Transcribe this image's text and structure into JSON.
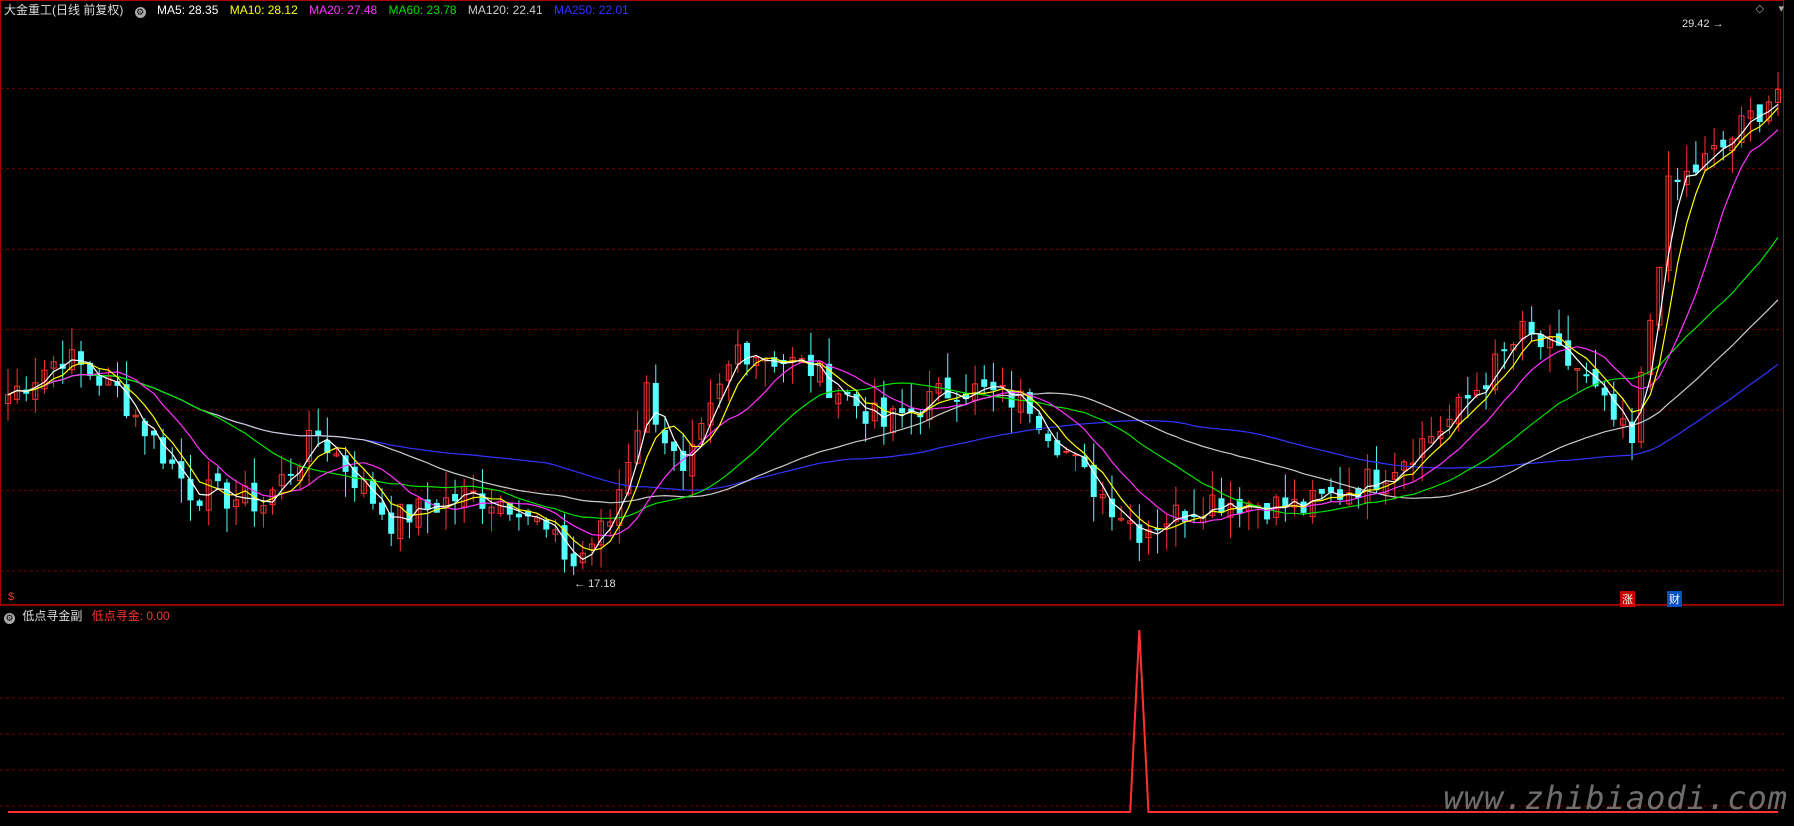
{
  "header": {
    "title": "大金重工(日线 前复权)",
    "ma": [
      {
        "label": "MA5: 28.35",
        "color": "#ffffff"
      },
      {
        "label": "MA10: 28.12",
        "color": "#ffff00"
      },
      {
        "label": "MA20: 27.48",
        "color": "#ff33ff"
      },
      {
        "label": "MA60: 23.78",
        "color": "#00e000"
      },
      {
        "label": "MA120: 22.41",
        "color": "#cccccc"
      },
      {
        "label": "MA250: 22.01",
        "color": "#3333ff"
      }
    ]
  },
  "annotations": {
    "high_label": "29.42",
    "low_label": "17.18",
    "price_marker": "$",
    "tag_zhang": "涨",
    "tag_cai": "财"
  },
  "sub_panel": {
    "title": "低点寻金副",
    "indicator_label": "低点寻金: 0.00"
  },
  "watermark": "www.zhibiaodi.com",
  "colors": {
    "up": "#ff3232",
    "down": "#54ffff",
    "grid": "#7a0000",
    "border": "#aa0000",
    "ma5": "#ffffff",
    "ma10": "#ffff00",
    "ma20": "#ff33ff",
    "ma60": "#00e000",
    "ma120": "#cccccc",
    "ma250": "#3333ff"
  },
  "chart_data": {
    "type": "candlestick",
    "ylim": [
      16.5,
      30.2
    ],
    "key_points": [
      {
        "t": 0,
        "v": 21.3
      },
      {
        "t": 6,
        "v": 22.2
      },
      {
        "t": 12,
        "v": 21.4
      },
      {
        "t": 20,
        "v": 19.1
      },
      {
        "t": 28,
        "v": 18.8
      },
      {
        "t": 34,
        "v": 20.4
      },
      {
        "t": 42,
        "v": 18.4
      },
      {
        "t": 50,
        "v": 19.0
      },
      {
        "t": 56,
        "v": 18.8
      },
      {
        "t": 62,
        "v": 17.4
      },
      {
        "t": 66,
        "v": 18.4
      },
      {
        "t": 70,
        "v": 21.4
      },
      {
        "t": 74,
        "v": 19.3
      },
      {
        "t": 80,
        "v": 22.4
      },
      {
        "t": 88,
        "v": 21.9
      },
      {
        "t": 96,
        "v": 20.6
      },
      {
        "t": 104,
        "v": 21.5
      },
      {
        "t": 112,
        "v": 21.1
      },
      {
        "t": 118,
        "v": 19.4
      },
      {
        "t": 124,
        "v": 18.2
      },
      {
        "t": 132,
        "v": 18.9
      },
      {
        "t": 142,
        "v": 18.7
      },
      {
        "t": 150,
        "v": 19.4
      },
      {
        "t": 158,
        "v": 20.7
      },
      {
        "t": 166,
        "v": 22.7
      },
      {
        "t": 172,
        "v": 21.9
      },
      {
        "t": 178,
        "v": 20.1
      },
      {
        "t": 182,
        "v": 26.0
      },
      {
        "t": 188,
        "v": 27.0
      },
      {
        "t": 194,
        "v": 28.35
      }
    ],
    "high": {
      "value": 29.42,
      "label": "29.42"
    },
    "low": {
      "value": 17.18,
      "label": "17.18"
    },
    "ma_levels": {
      "MA5": 28.35,
      "MA10": 28.12,
      "MA20": 27.48,
      "MA60": 23.78,
      "MA120": 22.41,
      "MA250": 22.01
    },
    "indicator": {
      "name": "低点寻金",
      "current": 0.0,
      "spike_index": 124,
      "spike_value": 1.0
    }
  }
}
